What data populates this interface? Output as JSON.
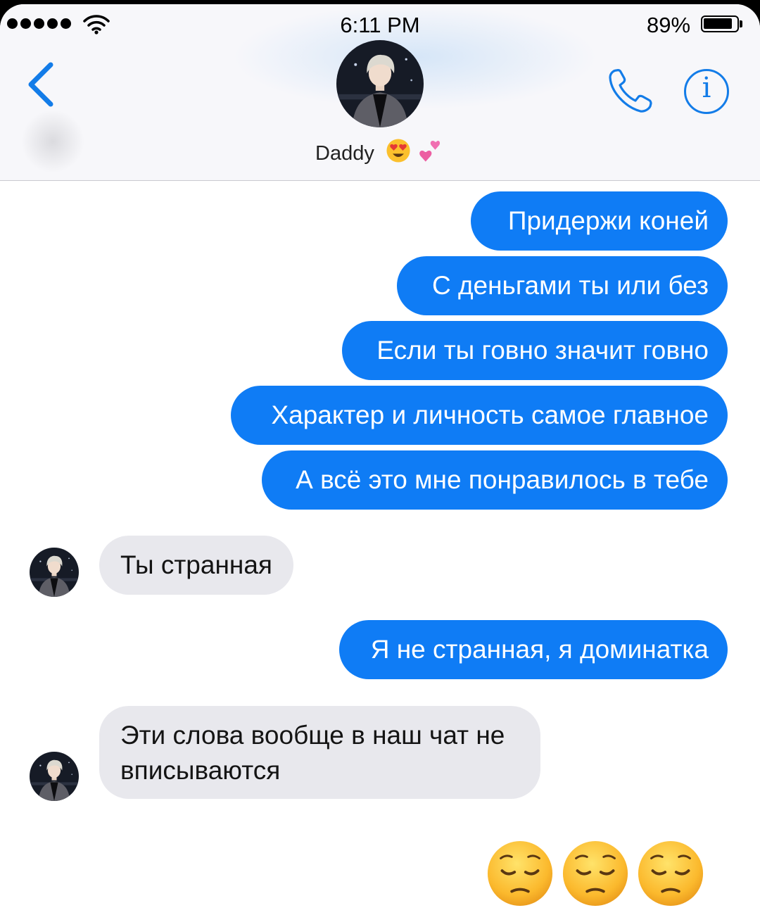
{
  "status_bar": {
    "time": "6:11 PM",
    "battery_percent": "89%",
    "battery_level": 0.89
  },
  "header": {
    "contact_name": "Daddy",
    "contact_emoji": [
      "heart-eyes-face",
      "two-hearts"
    ],
    "icons": [
      "back-chevron-icon",
      "phone-icon",
      "info-icon"
    ],
    "accent_color": "#137ce8"
  },
  "messages": [
    {
      "direction": "sent",
      "text": "Придержи коней"
    },
    {
      "direction": "sent",
      "text": "С деньгами ты или без"
    },
    {
      "direction": "sent",
      "text": "Если ты говно значит говно"
    },
    {
      "direction": "sent",
      "text": "Характер и личность самое главное"
    },
    {
      "direction": "sent",
      "text": "А всё это мне понравилось в тебе"
    },
    {
      "direction": "received",
      "text": "Ты странная"
    },
    {
      "direction": "sent",
      "text": "Я не странная, я доминатка"
    },
    {
      "direction": "received",
      "lines": [
        "Эти слова вообще в наш чат не",
        "вписываются"
      ]
    },
    {
      "direction": "sent",
      "emoji": [
        "pensive-face",
        "pensive-face",
        "pensive-face"
      ]
    }
  ],
  "colors": {
    "sent_bubble": "#0f7cf5",
    "received_bubble": "#e8e8ed",
    "header_bg": "#f7f7fa"
  }
}
